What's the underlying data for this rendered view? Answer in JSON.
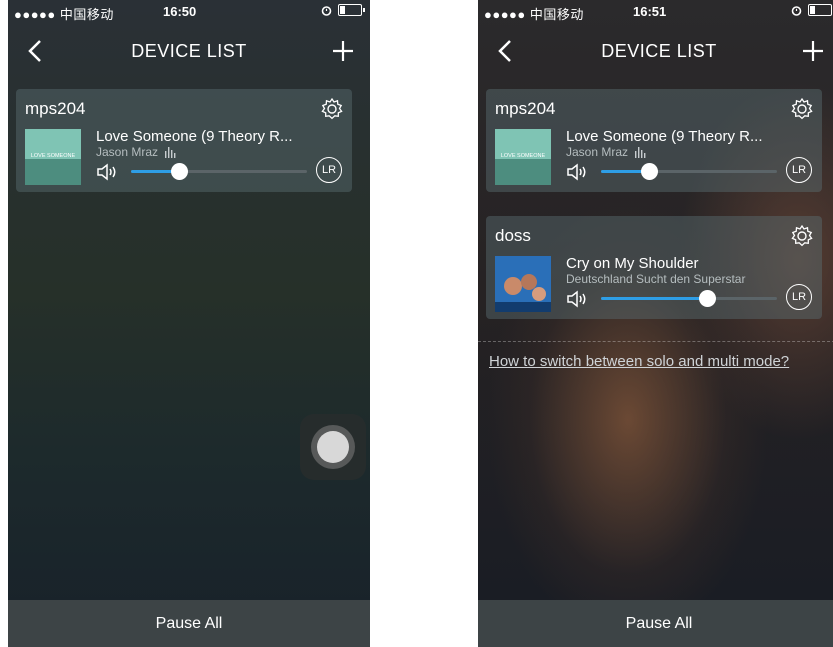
{
  "status_left": {
    "carrier": "●●●●● 中国移动",
    "time": "16:50"
  },
  "status_right": {
    "carrier": "●●●●● 中国移动",
    "time": "16:51"
  },
  "nav": {
    "title": "DEVICE LIST"
  },
  "left_cards": [
    {
      "name": "mps204",
      "title": "Love Someone (9 Theory R...",
      "artist": "Jason Mraz",
      "volume": 0.27,
      "lr": "LR"
    }
  ],
  "right_cards": [
    {
      "name": "mps204",
      "title": "Love Someone (9 Theory R...",
      "artist": "Jason Mraz",
      "volume": 0.27,
      "lr": "LR"
    },
    {
      "name": "doss",
      "title": "Cry on My Shoulder",
      "artist": "Deutschland Sucht den Superstar",
      "volume": 0.6,
      "lr": "LR"
    }
  ],
  "help_link": "How to switch between solo and multi mode?",
  "bottom": {
    "pause_all": "Pause All"
  },
  "colors": {
    "accent": "#2e9ee6"
  },
  "icons": [
    "wifi-icon",
    "alarm-icon",
    "battery-icon",
    "back-icon",
    "plus-icon",
    "gear-icon",
    "volume-icon",
    "equalizer-icon",
    "lr-icon",
    "assistive-touch-icon"
  ],
  "cover_captions": {
    "love_someone": "LOVE SOMEONE"
  }
}
